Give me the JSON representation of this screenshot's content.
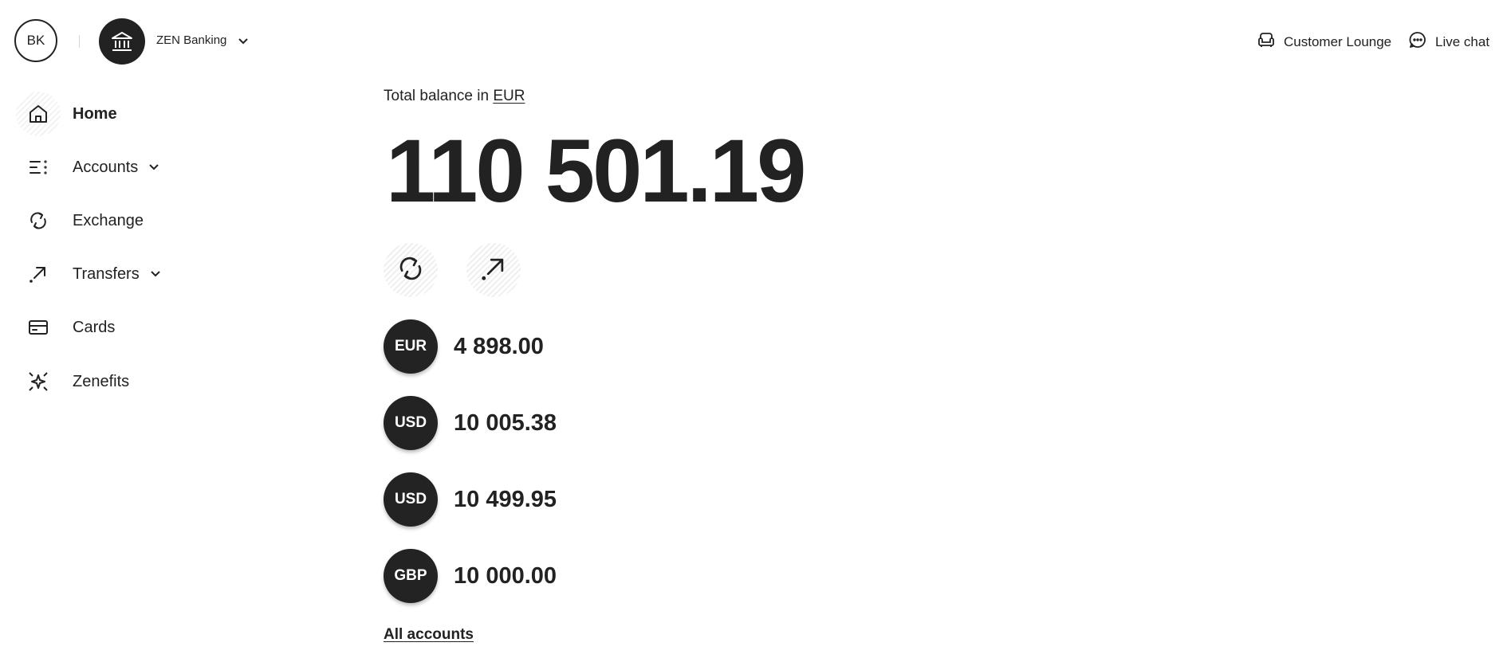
{
  "header": {
    "avatar_initials": "BK",
    "org_name": "ZEN Banking",
    "customer_lounge": "Customer Lounge",
    "live_chat": "Live chat"
  },
  "sidebar": {
    "items": [
      {
        "label": "Home",
        "icon": "home-icon",
        "active": true
      },
      {
        "label": "Accounts",
        "icon": "accounts-icon",
        "has_dropdown": true
      },
      {
        "label": "Exchange",
        "icon": "exchange-icon"
      },
      {
        "label": "Transfers",
        "icon": "transfer-arrow-icon",
        "has_dropdown": true
      },
      {
        "label": "Cards",
        "icon": "card-icon"
      },
      {
        "label": "Zenefits",
        "icon": "sparkle-icon"
      }
    ]
  },
  "main": {
    "balance_label_prefix": "Total balance in",
    "balance_currency": "EUR",
    "total_balance": "110 501.19",
    "actions": [
      {
        "name": "exchange",
        "icon": "exchange-icon"
      },
      {
        "name": "transfer",
        "icon": "transfer-arrow-icon"
      }
    ],
    "accounts": [
      {
        "currency": "EUR",
        "amount": "4 898.00"
      },
      {
        "currency": "USD",
        "amount": "10 005.38"
      },
      {
        "currency": "USD",
        "amount": "10 499.95"
      },
      {
        "currency": "GBP",
        "amount": "10 000.00"
      }
    ],
    "all_accounts_link": "All accounts"
  },
  "colors": {
    "text": "#222222",
    "currency_badge": "#232323",
    "background": "#ffffff"
  }
}
